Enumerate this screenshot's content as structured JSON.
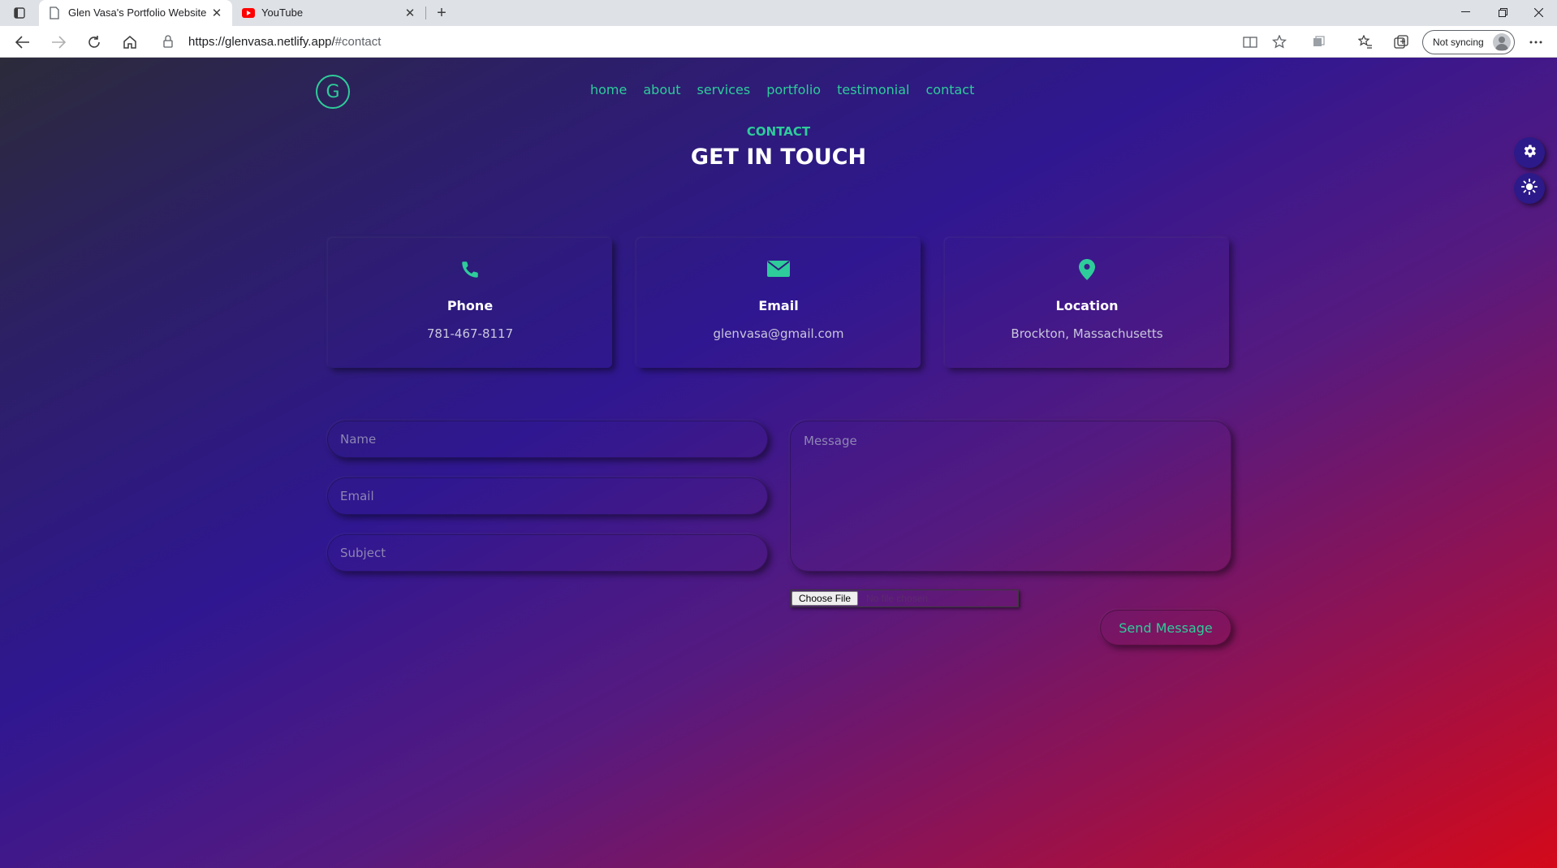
{
  "browser": {
    "tabs": [
      {
        "title": "Glen Vasa's Portfolio Website",
        "active": true
      },
      {
        "title": "YouTube",
        "active": false
      }
    ],
    "url_host": "https://glenvasa.netlify.app/",
    "url_rest": "#contact",
    "sync_label": "Not syncing"
  },
  "site": {
    "logo_letter": "G",
    "nav": [
      "home",
      "about",
      "services",
      "portfolio",
      "testimonial",
      "contact"
    ],
    "section_kicker": "CONTACT",
    "section_title": "GET IN TOUCH",
    "cards": [
      {
        "icon": "phone-icon",
        "label": "Phone",
        "value": "781-467-8117"
      },
      {
        "icon": "envelope-icon",
        "label": "Email",
        "value": "glenvasa@gmail.com"
      },
      {
        "icon": "map-pin-icon",
        "label": "Location",
        "value": "Brockton, Massachusetts"
      }
    ],
    "form": {
      "name_placeholder": "Name",
      "email_placeholder": "Email",
      "subject_placeholder": "Subject",
      "message_placeholder": "Message",
      "file_button": "Choose File",
      "file_status": "No file chosen",
      "submit_label": "Send Message"
    }
  },
  "colors": {
    "accent": "#2ecc9a",
    "gradient": [
      "#2b2b3a",
      "#2f1791",
      "#931250",
      "#d4091a"
    ]
  }
}
